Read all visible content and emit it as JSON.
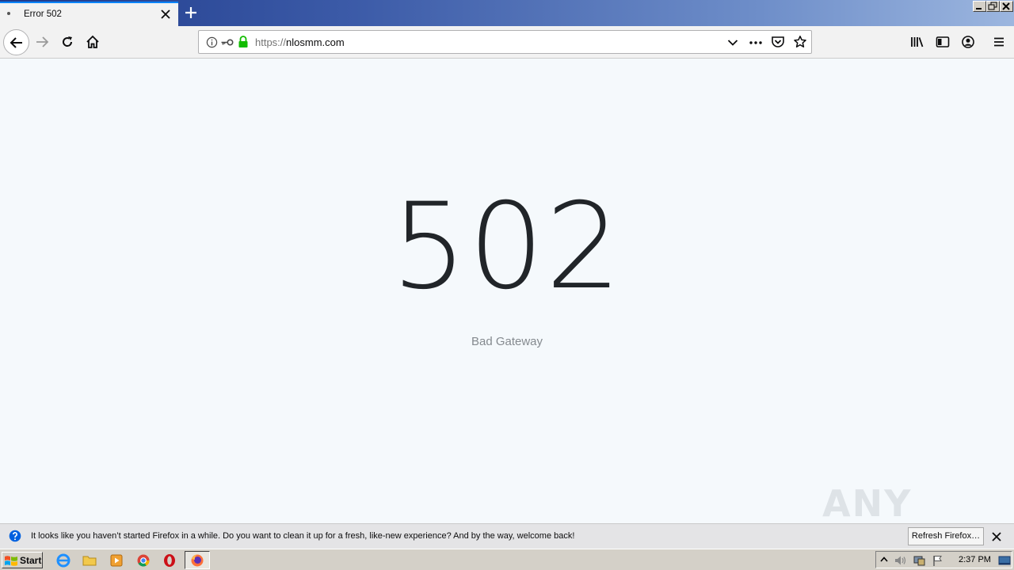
{
  "tab": {
    "title": "Error 502"
  },
  "window": {
    "new_tab_icon": "plus-icon"
  },
  "navbar": {
    "url_protocol": "https://",
    "url_host": "nlosmm.com"
  },
  "page": {
    "error_code": "502",
    "error_message": "Bad Gateway",
    "watermark": "ANY RUN"
  },
  "notification": {
    "text": "It looks like you haven’t started Firefox in a while. Do you want to clean it up for a fresh, like-new experience? And by the way, welcome back!",
    "button_label": "Refresh Firefox…"
  },
  "taskbar": {
    "start_label": "Start",
    "clock": "2:37 PM"
  },
  "colors": {
    "accent": "#0a84ff",
    "page_bg": "#f5f9fc",
    "error_code": "#212529",
    "secure_lock": "#12bc00"
  }
}
